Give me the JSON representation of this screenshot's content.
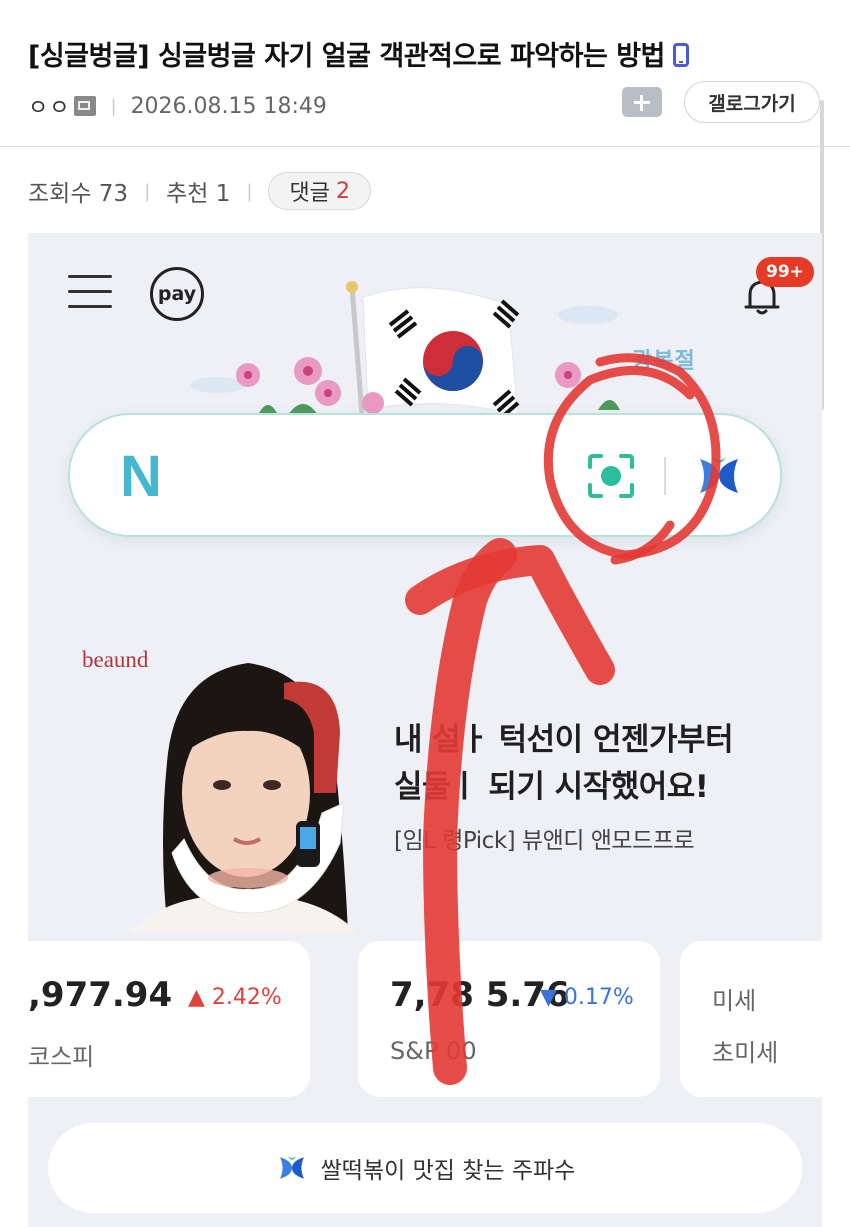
{
  "post": {
    "title": "[싱글벙글] 싱글벙글 자기 얼굴 객관적으로 파악하는 방법",
    "author": "ㅇㅇ",
    "timestamp": "2026.08.15 18:49",
    "gallery_button": "갤로그가기"
  },
  "stats": {
    "views_label": "조회수 73",
    "recommend_label": "추천 1",
    "comments_label": "댓글",
    "comments_count": "2"
  },
  "app": {
    "pay_label": "pay",
    "notification_badge": "99+",
    "doodle_label": "광복절",
    "search": {
      "logo": "N"
    },
    "ad": {
      "brand": "beaund",
      "title": "내 설ㅏ 턱선이 언젠가부터\n실둘ㅣ 되기 시작했어요!",
      "subtitle": "[임L 령Pick] 뷰앤디 앤모드프로"
    },
    "cards": [
      {
        "value": ",977.94",
        "change": "▲ 2.42%",
        "label": "코스피"
      },
      {
        "value": "7,78 5.76",
        "change": "▼ 0.17%",
        "label": "S&P 00"
      },
      {
        "line1": "미세",
        "line2": "초미세"
      }
    ],
    "bottom_button": "쌀떡볶이 맛집 찾는 주파수"
  },
  "colors": {
    "accent_red": "#e0433b",
    "down_blue": "#3a73d6",
    "naver_green": "#45b8cf",
    "annotation_red": "#e33a35"
  }
}
